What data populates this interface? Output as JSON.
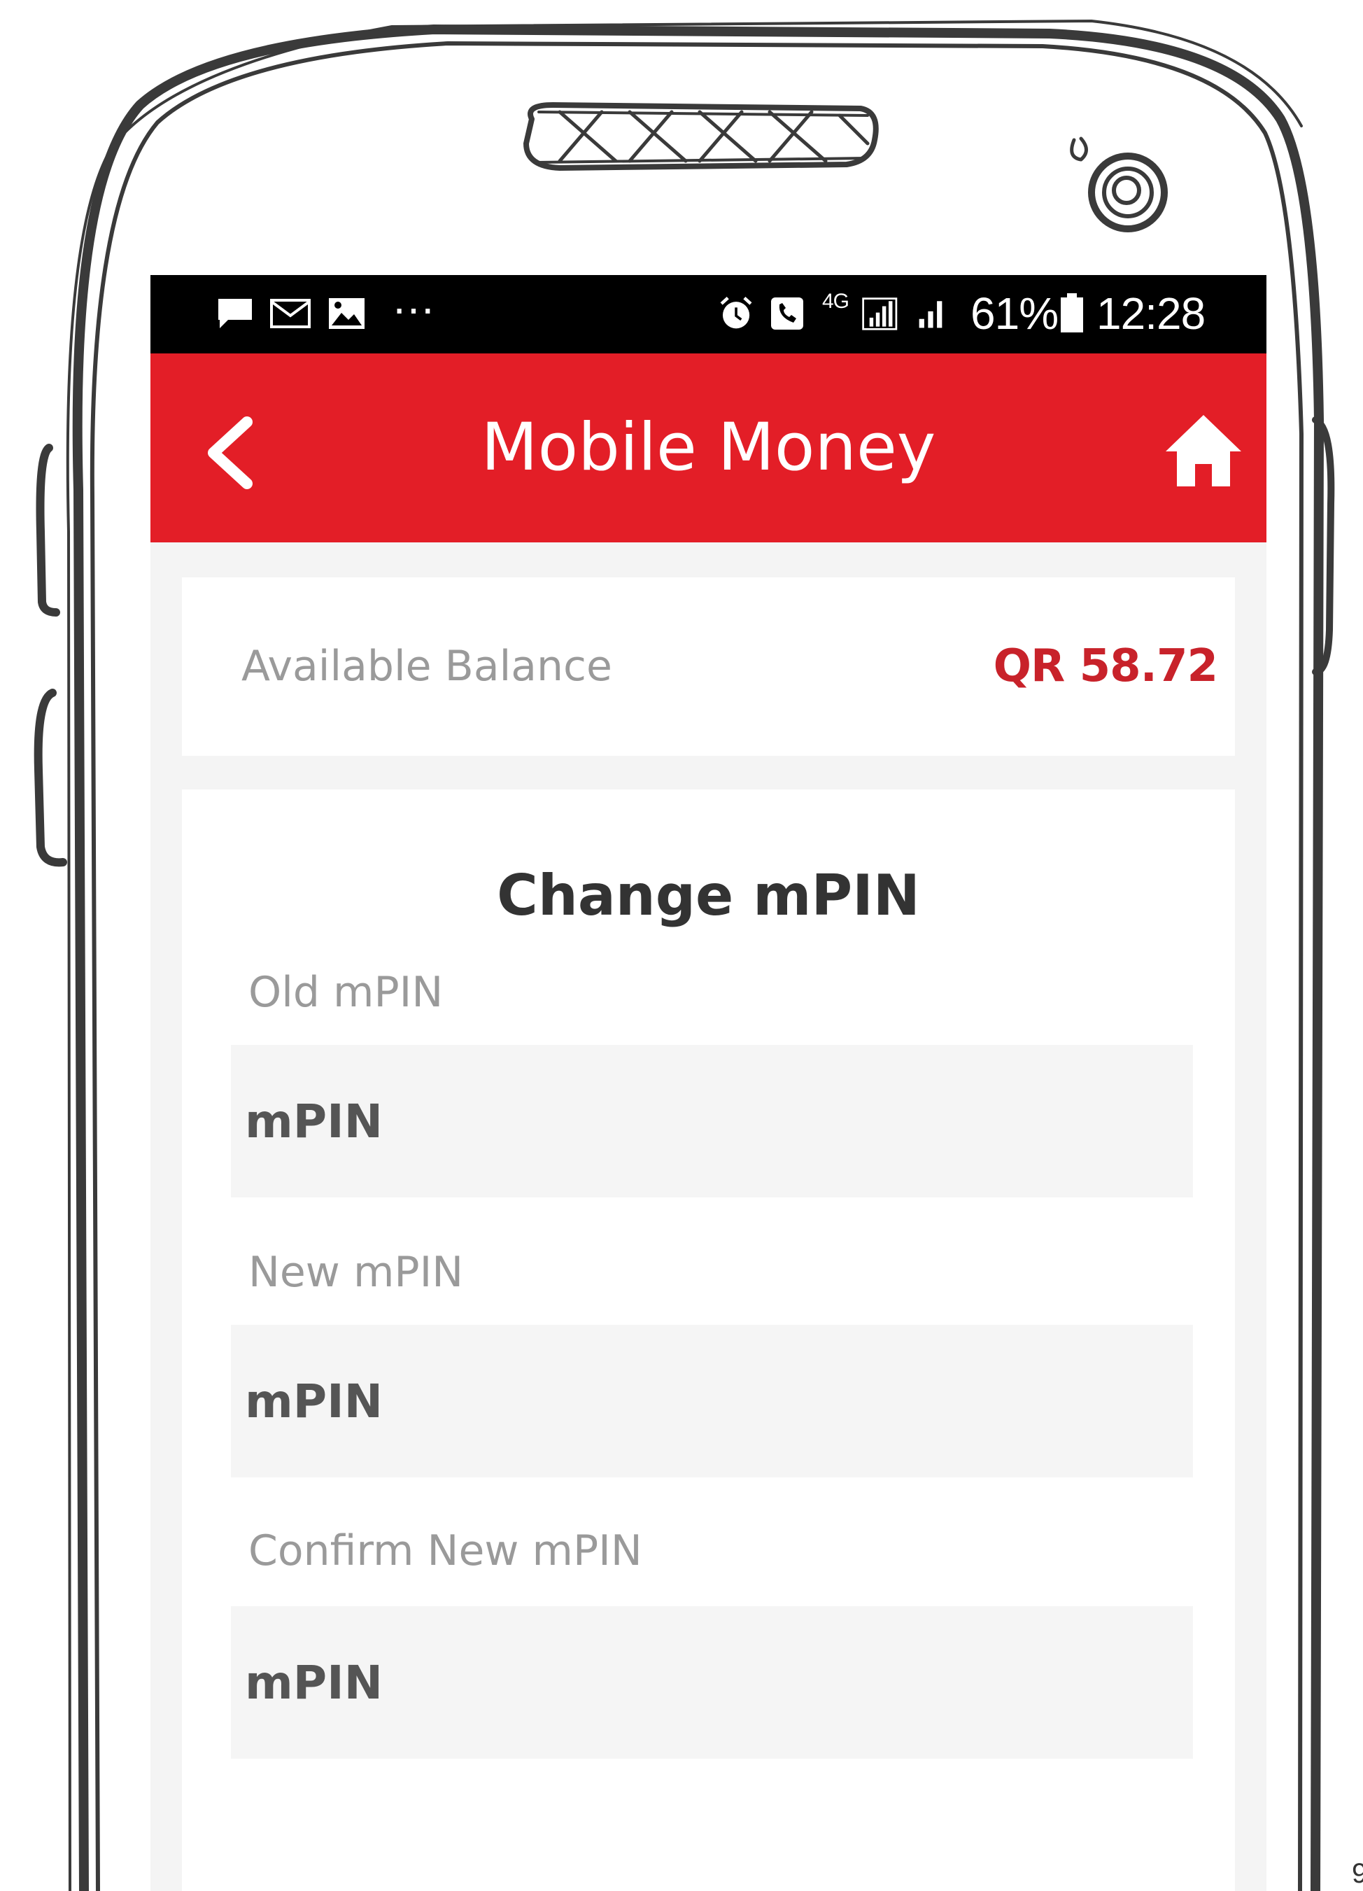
{
  "status_bar": {
    "battery_percent": "61%",
    "time": "12:28",
    "network_label": "4G",
    "more_indicator": "···",
    "icons": [
      "chat-icon",
      "mail-icon",
      "image-icon",
      "alarm-icon",
      "phone-icon",
      "signal-icon",
      "battery-icon"
    ]
  },
  "header": {
    "title": "Mobile Money",
    "back_icon": "chevron-left-icon",
    "home_icon": "home-icon"
  },
  "balance": {
    "label": "Available Balance",
    "value": "QR 58.72"
  },
  "form": {
    "title": "Change mPIN",
    "fields": [
      {
        "label": "Old mPIN",
        "placeholder": "mPIN"
      },
      {
        "label": "New mPIN",
        "placeholder": "mPIN"
      },
      {
        "label": "Confirm New mPIN",
        "placeholder": "mPIN"
      }
    ]
  },
  "colors": {
    "header_red": "#e31e27",
    "balance_red": "#c8222a",
    "status_bar": "#000000",
    "background": "#f4f4f4"
  }
}
